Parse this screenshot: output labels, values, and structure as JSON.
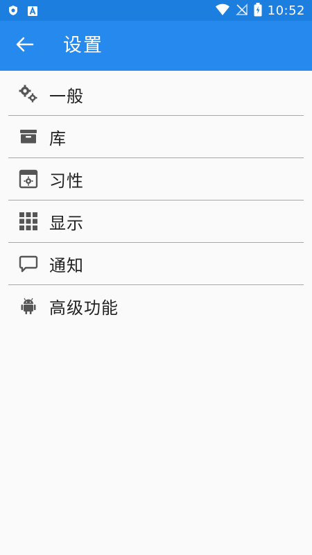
{
  "status_bar": {
    "time": "10:52",
    "left_icons": [
      "shield-icon",
      "app-a-icon"
    ],
    "right_icons": [
      "wifi-icon",
      "no-signal-icon",
      "battery-charging-icon"
    ],
    "background": "#1c7fe0"
  },
  "app_bar": {
    "title": "设置",
    "back_icon": "arrow-left-icon",
    "background": "#2589ee"
  },
  "menu": {
    "items": [
      {
        "label": "一般",
        "icon": "gears-icon"
      },
      {
        "label": "库",
        "icon": "archive-box-icon"
      },
      {
        "label": "习性",
        "icon": "window-settings-icon"
      },
      {
        "label": "显示",
        "icon": "grid-icon"
      },
      {
        "label": "通知",
        "icon": "chat-bubble-icon"
      },
      {
        "label": "高级功能",
        "icon": "android-icon"
      }
    ]
  }
}
